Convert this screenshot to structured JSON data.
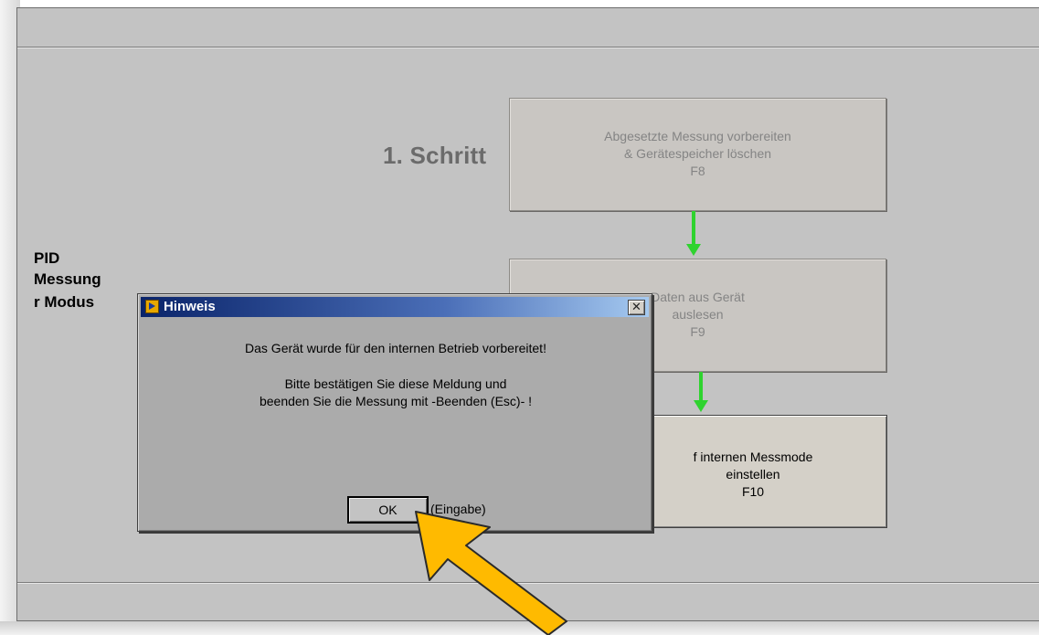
{
  "background_window": {
    "step_heading": "1. Schritt",
    "side_labels": [
      "PID",
      "Messung",
      "r Modus"
    ],
    "steps": [
      {
        "line1": "Abgesetzte Messung vorbereiten",
        "line2": "& Gerätespeicher löschen",
        "key": "F8"
      },
      {
        "line1": "Daten aus Gerät",
        "line2": "auslesen",
        "key": "F9"
      },
      {
        "line1": "f internen Messmode",
        "line2": "einstellen",
        "key": "F10"
      }
    ]
  },
  "dialog": {
    "title": "Hinweis",
    "close_glyph": "✕",
    "message_line1": "Das Gerät wurde für den internen Betrieb vorbereitet!",
    "message_line2": "Bitte bestätigen Sie diese Meldung und",
    "message_line3": "beenden Sie die Messung mit -Beenden (Esc)- !",
    "ok_label": "OK",
    "ok_hint": "(Eingabe)"
  },
  "colors": {
    "arrow_green": "#2fd32f",
    "pointer_yellow": "#ffba00",
    "titlebar_blue": "#0a246a"
  }
}
